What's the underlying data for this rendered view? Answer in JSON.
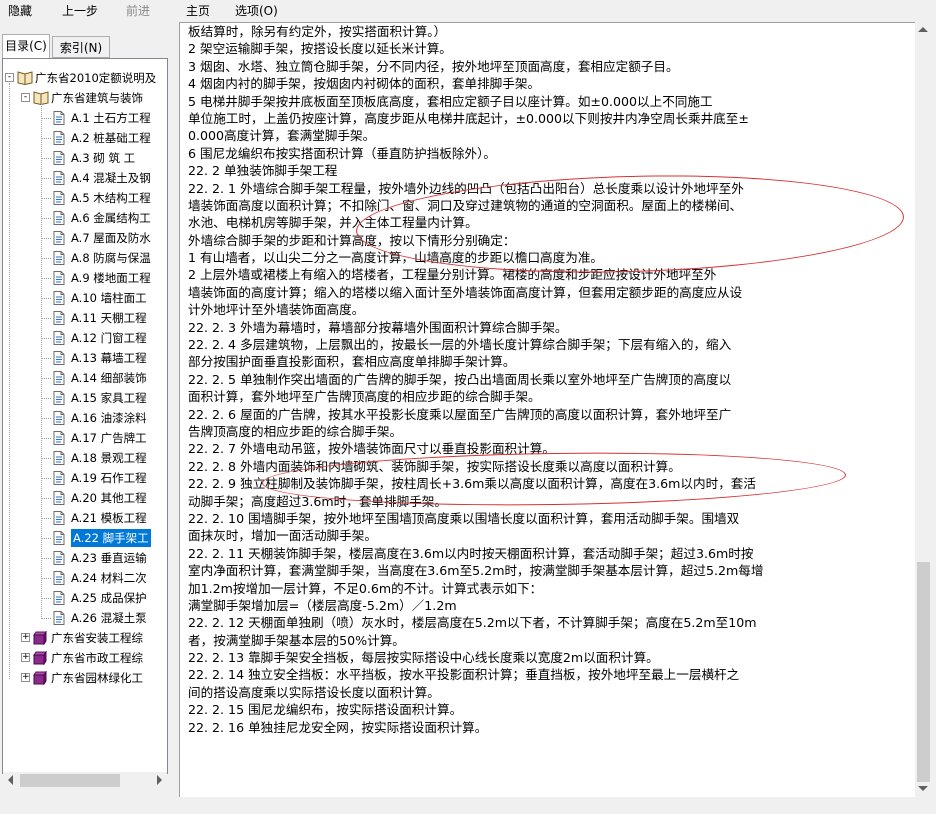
{
  "toolbar": {
    "hide": "隐藏",
    "back": "上一步",
    "forward": "前进",
    "home": "主页",
    "options": "选项(O)"
  },
  "tabs": {
    "contents": "目录(C)",
    "index": "索引(N)"
  },
  "tree": [
    {
      "label": "广东省2010定额说明及",
      "level": 0,
      "icon": "open-book-icon",
      "exp": "-"
    },
    {
      "label": "广东省建筑与装饰",
      "level": 1,
      "icon": "open-book-icon",
      "exp": "-"
    },
    {
      "label": "A.1  土石方工程",
      "level": 2,
      "icon": "page-icon"
    },
    {
      "label": "A.2  桩基础工程",
      "level": 2,
      "icon": "page-icon"
    },
    {
      "label": "A.3  砌 筑 工",
      "level": 2,
      "icon": "page-icon"
    },
    {
      "label": "A.4  混凝土及钢",
      "level": 2,
      "icon": "page-icon"
    },
    {
      "label": "A.5  木结构工程",
      "level": 2,
      "icon": "page-icon"
    },
    {
      "label": "A.6  金属结构工",
      "level": 2,
      "icon": "page-icon"
    },
    {
      "label": "A.7  屋面及防水",
      "level": 2,
      "icon": "page-icon"
    },
    {
      "label": "A.8  防腐与保温",
      "level": 2,
      "icon": "page-icon"
    },
    {
      "label": "A.9  楼地面工程",
      "level": 2,
      "icon": "page-icon"
    },
    {
      "label": "A.10  墙柱面工",
      "level": 2,
      "icon": "page-icon"
    },
    {
      "label": "A.11  天棚工程",
      "level": 2,
      "icon": "page-icon"
    },
    {
      "label": "A.12  门窗工程",
      "level": 2,
      "icon": "page-icon"
    },
    {
      "label": "A.13  幕墙工程",
      "level": 2,
      "icon": "page-icon"
    },
    {
      "label": "A.14  细部装饰",
      "level": 2,
      "icon": "page-icon"
    },
    {
      "label": "A.15  家具工程",
      "level": 2,
      "icon": "page-icon"
    },
    {
      "label": "A.16  油漆涂料",
      "level": 2,
      "icon": "page-icon"
    },
    {
      "label": "A.17  广告牌工",
      "level": 2,
      "icon": "page-icon"
    },
    {
      "label": "A.18  景观工程",
      "level": 2,
      "icon": "page-icon"
    },
    {
      "label": "A.19  石作工程",
      "level": 2,
      "icon": "page-icon"
    },
    {
      "label": "A.20  其他工程",
      "level": 2,
      "icon": "page-icon"
    },
    {
      "label": "A.21  模板工程",
      "level": 2,
      "icon": "page-icon"
    },
    {
      "label": "A.22  脚手架工",
      "level": 2,
      "icon": "page-icon",
      "selected": true
    },
    {
      "label": "A.23  垂直运输",
      "level": 2,
      "icon": "page-icon"
    },
    {
      "label": "A.24  材料二次",
      "level": 2,
      "icon": "page-icon"
    },
    {
      "label": "A.25  成品保护",
      "level": 2,
      "icon": "page-icon"
    },
    {
      "label": "A.26  混凝土泵",
      "level": 2,
      "icon": "page-icon"
    },
    {
      "label": "广东省安装工程综",
      "level": 1,
      "icon": "closed-book-icon",
      "exp": "+"
    },
    {
      "label": "广东省市政工程综",
      "level": 1,
      "icon": "closed-book-icon",
      "exp": "+"
    },
    {
      "label": "广东省园林绿化工",
      "level": 1,
      "icon": "closed-book-icon",
      "exp": "+"
    }
  ],
  "content": {
    "lines": [
      "板结算时，除另有约定外，按实搭面积计算。）",
      "    2  架空运输脚手架，按搭设长度以延长米计算。",
      "    3  烟囱、水塔、独立筒仓脚手架，分不同内径，按外地坪至顶面高度，套相应定额子目。",
      "    4  烟囱内衬的脚手架，按烟囱内衬砌体的面积，套单排脚手架。",
      "    5  电梯井脚手架按井底板面至顶板底高度，套相应定额子目以座计算。如±0.000以上不同施工",
      "单位施工时，上盖仍按座计算，高度步距从电梯井底起计，±0.000以下则按井内净空周长乘井底至±",
      "0.000高度计算，套满堂脚手架。",
      "    6  围尼龙编织布按实搭面积计算（垂直防护挡板除外）。",
      "22. 2  单独装饰脚手架工程",
      "22. 2. 1 外墙综合脚手架工程量，按外墙外边线的凹凸（包括凸出阳台）总长度乘以设计外地坪至外",
      "墙装饰面高度以面积计算；不扣除门、窗、洞口及穿过建筑物的通道的空洞面积。屋面上的楼梯间、",
      "水池、电梯机房等脚手架，并入主体工程量内计算。",
      "    外墙综合脚手架的步距和计算高度，按以下情形分别确定：",
      "    1  有山墙者，以山尖二分之一高度计算，山墙高度的步距以檐口高度为准。",
      "    2  上层外墙或裙楼上有缩入的塔楼者，工程量分别计算。裙楼的高度和步距应按设计外地坪至外",
      "墙装饰面的高度计算；缩入的塔楼以缩入面计至外墙装饰面高度计算，但套用定额步距的高度应从设",
      "计外地坪计至外墙装饰面高度。",
      "22. 2. 3  外墙为幕墙时，幕墙部分按幕墙外围面积计算综合脚手架。",
      "22. 2. 4  多层建筑物，上层飘出的，按最长一层的外墙长度计算综合脚手架；下层有缩入的，缩入",
      "部分按围护面垂直投影面积，套相应高度单排脚手架计算。",
      "22. 2. 5  单独制作突出墙面的广告牌的脚手架，按凸出墙面周长乘以室外地坪至广告牌顶的高度以",
      "面积计算，套外地坪至广告牌顶高度的相应步距的综合脚手架。",
      "22. 2. 6  屋面的广告牌，按其水平投影长度乘以屋面至广告牌顶的高度以面积计算，套外地坪至广",
      "告牌顶高度的相应步距的综合脚手架。",
      "22. 2. 7  外墙电动吊篮，按外墙装饰面尺寸以垂直投影面积计算。",
      "22. 2. 8  外墙内面装饰和内墙砌筑、装饰脚手架，按实际搭设长度乘以高度以面积计算。",
      "22. 2. 9  独立柱脚制及装饰脚手架，按柱周长+3.6m乘以高度以面积计算，高度在3.6m以内时，套活",
      "动脚手架；高度超过3.6m时，套单排脚手架。",
      "22. 2. 10  围墙脚手架，按外地坪至围墙顶高度乘以围墙长度以面积计算，套用活动脚手架。围墙双",
      "面抹灰时，增加一面活动脚手架。",
      "22. 2. 11  天棚装饰脚手架，楼层高度在3.6m以内时按天棚面积计算，套活动脚手架；超过3.6m时按",
      "室内净面积计算，套满堂脚手架，当高度在3.6m至5.2m时，按满堂脚手架基本层计算，超过5.2m每增",
      "加1.2m按增加一层计算，不足0.6m的不计。计算式表示如下：",
      "    满堂脚手架增加层=（楼层高度-5.2m）／1.2m",
      "22. 2. 12  天棚面单独刷（喷）灰水时，楼层高度在5.2m以下者，不计算脚手架；高度在5.2m至10m",
      "者，按满堂脚手架基本层的50%计算。",
      "22. 2. 13  靠脚手架安全挡板，每层按实际搭设中心线长度乘以宽度2m以面积计算。",
      "22. 2. 14  独立安全挡板：水平挡板，按水平投影面积计算；垂直挡板，按外地坪至最上一层横杆之",
      "间的搭设高度乘以实际搭设长度以面积计算。",
      "22. 2. 15  围尼龙编织布，按实际搭设面积计算。",
      "22. 2. 16  单独挂尼龙安全网，按实际搭设面积计算。"
    ]
  },
  "colors": {
    "annotation": "#d93030",
    "selection": "#0078d7"
  }
}
